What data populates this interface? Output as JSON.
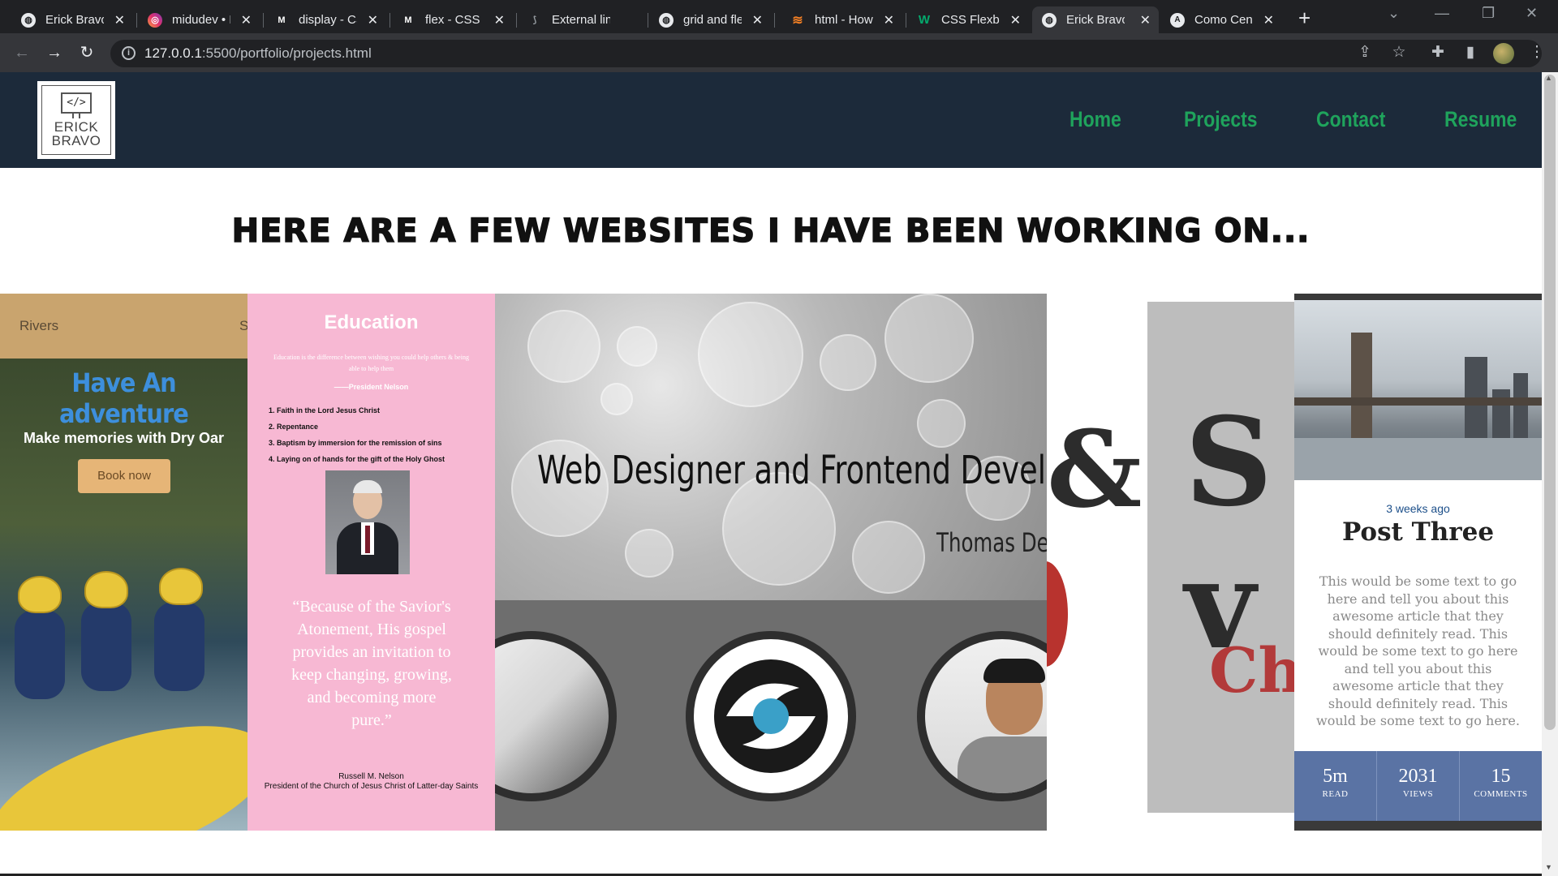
{
  "browser": {
    "tabs": [
      {
        "title": "Erick Bravo",
        "icon": "globe-icon",
        "color": "#ffffff"
      },
      {
        "title": "midudev • I",
        "icon": "instagram-icon",
        "color": "#e1306c"
      },
      {
        "title": "display - CS",
        "icon": "mdn-icon",
        "color": "#ffffff"
      },
      {
        "title": "flex - CSS | I",
        "icon": "mdn-icon",
        "color": "#ffffff"
      },
      {
        "title": "External link",
        "icon": "link-icon",
        "color": "#9aa0a6"
      },
      {
        "title": "grid and fle",
        "icon": "globe-icon",
        "color": "#ffffff"
      },
      {
        "title": "html - How",
        "icon": "stackoverflow-icon",
        "color": "#f48024"
      },
      {
        "title": "CSS Flexbox",
        "icon": "w3schools-icon",
        "color": "#04aa6d"
      },
      {
        "title": "Erick Bravo",
        "icon": "globe-icon",
        "color": "#ffffff",
        "active": true
      },
      {
        "title": "Como Cent",
        "icon": "astro-icon",
        "color": "#ffffff"
      }
    ],
    "url_host": "127.0.0.1",
    "url_path": ":5500/portfolio/projects.html"
  },
  "header": {
    "logo_text_line1": "ERICK",
    "logo_text_line2": "BRAVO",
    "logo_code": "</>",
    "nav": [
      "Home",
      "Projects",
      "Contact",
      "Resume"
    ],
    "nav_color": "#1fa35c",
    "background": "#1c2a3a"
  },
  "main": {
    "heading": "Here are a few websites I have been working on..."
  },
  "cards": {
    "rafting": {
      "nav_left": "Rivers",
      "nav_right": "S",
      "heading": "Have An adventure",
      "subheading": "Make memories with Dry Oar",
      "button": "Book now"
    },
    "education": {
      "title": "Education",
      "small_quote": "Education is the difference between wishing you could help others & being able to help them",
      "small_attribution": "——President Nelson",
      "list": [
        "1. Faith in the Lord Jesus Christ",
        "2. Repentance",
        "3. Baptism by immersion for the remission of sins",
        "4. Laying on of hands for the gift of the Holy Ghost"
      ],
      "quote": "“Because of the Savior's Atonement, His gospel provides an invitation to keep changing, growing, and becoming more pure.”",
      "author_name": "Russell M. Nelson",
      "author_title": "President of the Church of Jesus Christ of Latter-day Saints"
    },
    "portfolio": {
      "title": "Web Designer and Frontend Devel",
      "name": "Thomas De"
    },
    "typography": {
      "ampersand": "&",
      "big_letter": "S v",
      "red_text": "Ch"
    },
    "blog": {
      "date": "3 weeks ago",
      "title": "Post Three",
      "text": "This would be some text to go here and tell you about this awesome article that they should definitely read. This would be some text to go here and tell you about this awesome article that they should definitely read. This would be some text to go here.",
      "stats": [
        {
          "value": "5m",
          "label": "READ"
        },
        {
          "value": "2031",
          "label": "VIEWS"
        },
        {
          "value": "15",
          "label": "COMMENTS"
        }
      ]
    }
  }
}
